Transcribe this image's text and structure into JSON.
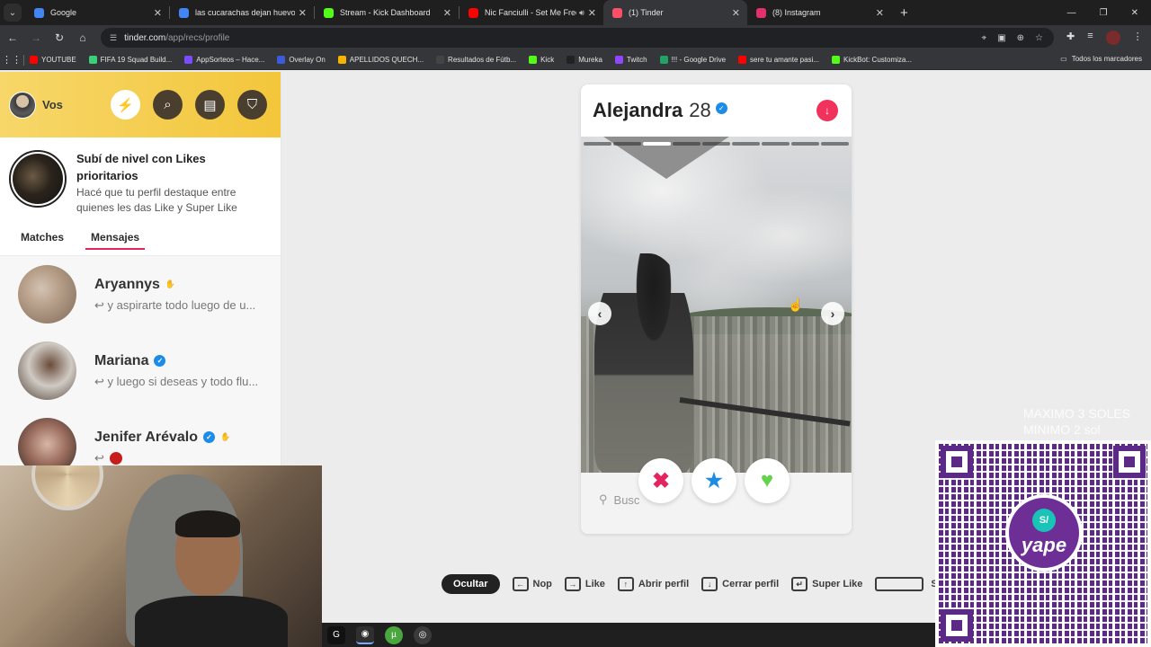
{
  "browser": {
    "tabs": [
      {
        "title": "Google",
        "favicon_color": "#4285f4",
        "active": false
      },
      {
        "title": "las cucarachas dejan huevos - B",
        "favicon_color": "#4285f4",
        "active": false
      },
      {
        "title": "Stream - Kick Dashboard",
        "favicon_color": "#53fc18",
        "active": false
      },
      {
        "title": "Nic Fanciulli - Set Me Free (",
        "favicon_color": "#ff0000",
        "active": false,
        "audio": true
      },
      {
        "title": "(1) Tinder",
        "favicon_color": "#fd5068",
        "active": true
      },
      {
        "title": "(8) Instagram",
        "favicon_color": "#e1306c",
        "active": false
      }
    ],
    "url_host": "tinder.com",
    "url_path": "/app/recs/profile",
    "bookmarks": [
      {
        "label": "YOUTUBE",
        "color": "#ff0000"
      },
      {
        "label": "FIFA 19 Squad Build...",
        "color": "#3ccf7a"
      },
      {
        "label": "AppSorteos – Hace...",
        "color": "#7a4dff"
      },
      {
        "label": "Overlay On",
        "color": "#3b5bdb"
      },
      {
        "label": "APELLIDOS QUECH...",
        "color": "#f4b400"
      },
      {
        "label": "Resultados de Fútb...",
        "color": "#444444"
      },
      {
        "label": "Kick",
        "color": "#53fc18"
      },
      {
        "label": "Mureka",
        "color": "#222222"
      },
      {
        "label": "Twitch",
        "color": "#9146ff"
      },
      {
        "label": "!!! - Google Drive",
        "color": "#1fa463"
      },
      {
        "label": "sere tu amante pasi...",
        "color": "#ff0000"
      },
      {
        "label": "KickBot: Customiza...",
        "color": "#53fc18"
      }
    ],
    "all_bookmarks": "Todos los marcadores"
  },
  "sidebar": {
    "user_name": "Vos",
    "promo_title": "Subí de nivel con Likes prioritarios",
    "promo_sub": "Hacé que tu perfil destaque entre quienes les das Like y Super Like",
    "tabs": [
      "Matches",
      "Mensajes"
    ],
    "messages": [
      {
        "name": "Aryannys",
        "preview": "y aspirarte todo luego de u...",
        "verified": false
      },
      {
        "name": "Mariana",
        "preview": "y luego si deseas y todo flu...",
        "verified": true
      },
      {
        "name": "Jenifer Arévalo",
        "preview": "",
        "verified": true
      }
    ]
  },
  "profile": {
    "name": "Alejandra",
    "age": "28",
    "photo_index": 3,
    "photo_count": 9,
    "search_placeholder": "Busc"
  },
  "hotkeys": {
    "hide": "Ocultar",
    "items": [
      {
        "key": "←",
        "label": "Nop"
      },
      {
        "key": "→",
        "label": "Like"
      },
      {
        "key": "↑",
        "label": "Abrir perfil"
      },
      {
        "key": "↓",
        "label": "Cerrar perfil"
      },
      {
        "key": "↵",
        "label": "Super Like"
      }
    ],
    "truncated": "S"
  },
  "overlay": {
    "donation_line1": "MAXIMO 3 SOLES",
    "donation_line2": "MINIMO 2 sol",
    "qr_currency": "S/",
    "qr_brand": "yape"
  }
}
